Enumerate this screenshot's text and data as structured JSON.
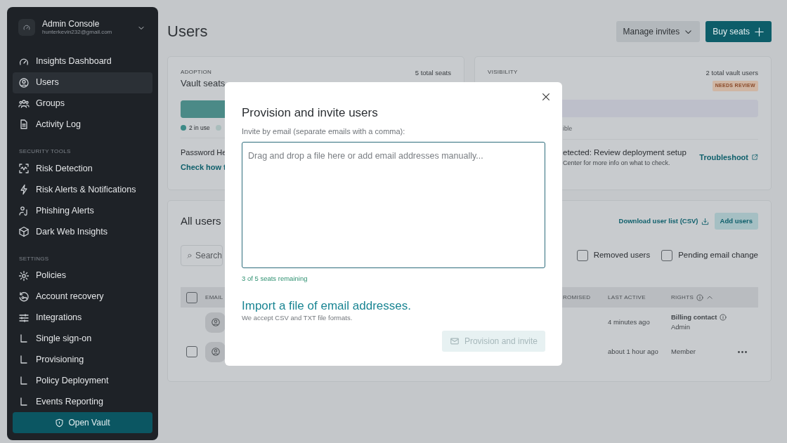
{
  "sidebar": {
    "account": {
      "title": "Admin Console",
      "email": "hunterkevin232@gmail.com"
    },
    "sections": [
      {
        "items": [
          {
            "label": "Insights Dashboard",
            "selected": false
          },
          {
            "label": "Users",
            "selected": true
          },
          {
            "label": "Groups",
            "selected": false
          },
          {
            "label": "Activity Log",
            "selected": false
          }
        ]
      },
      {
        "heading": "SECURITY TOOLS",
        "items": [
          {
            "label": "Risk Detection",
            "selected": false
          },
          {
            "label": "Risk Alerts & Notifications",
            "selected": false
          },
          {
            "label": "Phishing Alerts",
            "selected": false
          },
          {
            "label": "Dark Web Insights",
            "selected": false
          }
        ]
      },
      {
        "heading": "SETTINGS",
        "items": [
          {
            "label": "Policies",
            "selected": false
          },
          {
            "label": "Account recovery",
            "selected": false
          },
          {
            "label": "Integrations",
            "selected": false
          },
          {
            "label": "Single sign-on",
            "selected": false
          },
          {
            "label": "Provisioning",
            "selected": false
          },
          {
            "label": "Policy Deployment",
            "selected": false
          },
          {
            "label": "Events Reporting",
            "selected": false
          }
        ]
      }
    ],
    "open_vault": "Open Vault"
  },
  "header": {
    "title": "Users",
    "manage_invites": "Manage invites",
    "buy_seats": "Buy seats"
  },
  "adoption": {
    "eyebrow": "ADOPTION",
    "title": "Vault seats",
    "total": "5 total seats",
    "level": 0.4,
    "legend": [
      {
        "label": "2 in use",
        "color": "#3d8a87"
      },
      {
        "color": "#a9bdbc"
      }
    ],
    "password_label": "Password He",
    "link": "Check how t"
  },
  "visibility": {
    "eyebrow": "VISIBILITY",
    "total": "2 total vault users",
    "badge": "NEEDS REVIEW",
    "legend_fragment": "ible",
    "alert_title": "etected: Review deployment setup",
    "alert_text": "Center for more info on what to check.",
    "troubleshoot": "Troubleshoot"
  },
  "all_users": {
    "title": "All users",
    "download": "Download user list (CSV)",
    "add_users": "Add users",
    "search_placeholder": "Search",
    "filters": [
      {
        "label": "Removed users",
        "checked": false
      },
      {
        "label": "Pending email change",
        "checked": false
      }
    ],
    "select_all": {
      "checked": false
    },
    "columns": [
      "EMAIL",
      "ROMISED",
      "LAST ACTIVE",
      "RIGHTS"
    ],
    "rows": [
      {
        "checkbox": false,
        "last_active": "4 minutes ago",
        "rights": "Billing contact",
        "role": "Admin",
        "menu": false
      },
      {
        "checkbox": true,
        "checked": false,
        "last_active": "about 1 hour ago",
        "role": "Member",
        "menu": true
      }
    ]
  },
  "modal": {
    "title": "Provision and invite users",
    "label": "Invite by email (separate emails with a comma):",
    "placeholder": "Drag and drop a file here or add email addresses manually...",
    "seats_remaining": "3 of 5 seats remaining",
    "import_link": "Import a file of email addresses.",
    "import_hint": "We accept CSV and TXT file formats.",
    "submit": {
      "label": "Provision and invite",
      "disabled": true
    }
  }
}
